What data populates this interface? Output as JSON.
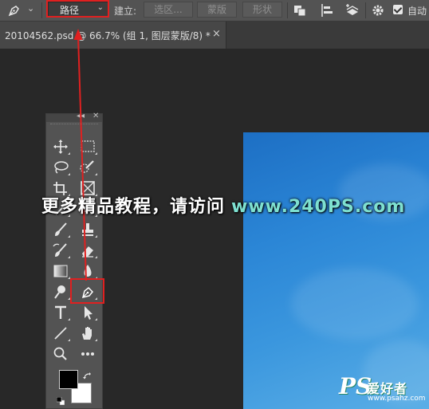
{
  "options_bar": {
    "mode_value": "路径",
    "make_label": "建立:",
    "selection_button": "选区...",
    "mask_button": "蒙版",
    "shape_button": "形状",
    "auto_label": "自动"
  },
  "document_tab": {
    "title": "20104562.psd @ 66.7% (组 1, 图层蒙版/8) *",
    "close": "×"
  },
  "tools_panel": {
    "collapse_glyph": "◂◂",
    "close_glyph": "✕",
    "active_tool": "pen-tool"
  },
  "colors": {
    "foreground": "#000000",
    "background": "#ffffff",
    "highlight": "#e02020"
  },
  "watermark": {
    "chinese_text": "更多精品教程，请访问",
    "url": "www.240PS.com"
  },
  "logo": {
    "ps": "PS",
    "chinese": "爱好者",
    "site": "www.psahz.com"
  }
}
